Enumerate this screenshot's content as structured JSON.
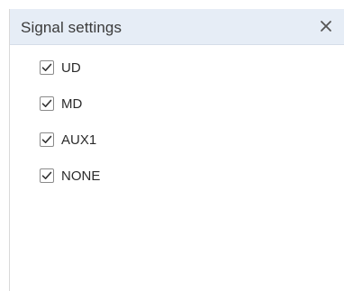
{
  "panel": {
    "title": "Signal settings",
    "close_icon": "close-icon"
  },
  "options": [
    {
      "label": "UD",
      "checked": true
    },
    {
      "label": "MD",
      "checked": true
    },
    {
      "label": "AUX1",
      "checked": true
    },
    {
      "label": "NONE",
      "checked": true
    }
  ],
  "colors": {
    "header_bg": "#e6edf6",
    "check_color": "#333333",
    "text": "#2b2b2b"
  }
}
